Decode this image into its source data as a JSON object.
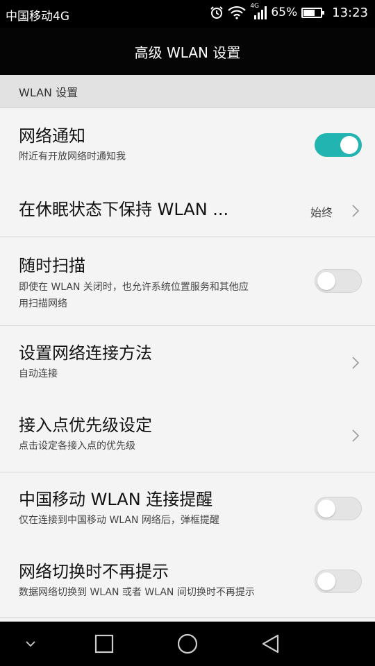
{
  "status_bar": {
    "carrier": "中国移动4G",
    "network_badge": "4G",
    "battery_percent": "65%",
    "battery_level": 0.65,
    "time": "13:23",
    "icons": [
      "alarm-icon",
      "wifi-icon",
      "signal-icon",
      "battery-icon"
    ]
  },
  "header": {
    "title": "高级 WLAN 设置"
  },
  "section": {
    "label": "WLAN 设置"
  },
  "items": [
    {
      "title": "网络通知",
      "subtitle": "附近有开放网络时通知我",
      "control": "toggle",
      "on": true
    },
    {
      "title": "在休眠状态下保持 WLAN ...",
      "value": "始终",
      "control": "chevron"
    },
    {
      "title": "随时扫描",
      "subtitle_lines": [
        "即使在 WLAN 关闭时，也允许系统位置服务和其他应",
        "用扫描网络"
      ],
      "control": "toggle",
      "on": false
    },
    {
      "title": "设置网络连接方法",
      "subtitle": "自动连接",
      "control": "chevron"
    },
    {
      "title": "接入点优先级设定",
      "subtitle": "点击设定各接入点的优先级",
      "control": "chevron"
    },
    {
      "title": "中国移动 WLAN 连接提醒",
      "subtitle": "仅在连接到中国移动 WLAN 网络后，弹框提醒",
      "control": "toggle",
      "on": false
    },
    {
      "title": "网络切换时不再提示",
      "subtitle": "数据网络切换到 WLAN 或者 WLAN 间切换时不再提示",
      "control": "toggle",
      "on": false
    }
  ],
  "colors": {
    "accent": "#22b4b0",
    "title_bar": "#050505",
    "section_bg": "#e2e2e2"
  },
  "nav_bar": {
    "buttons": [
      "chevron-down-icon",
      "recents-icon",
      "home-icon",
      "back-icon"
    ]
  }
}
